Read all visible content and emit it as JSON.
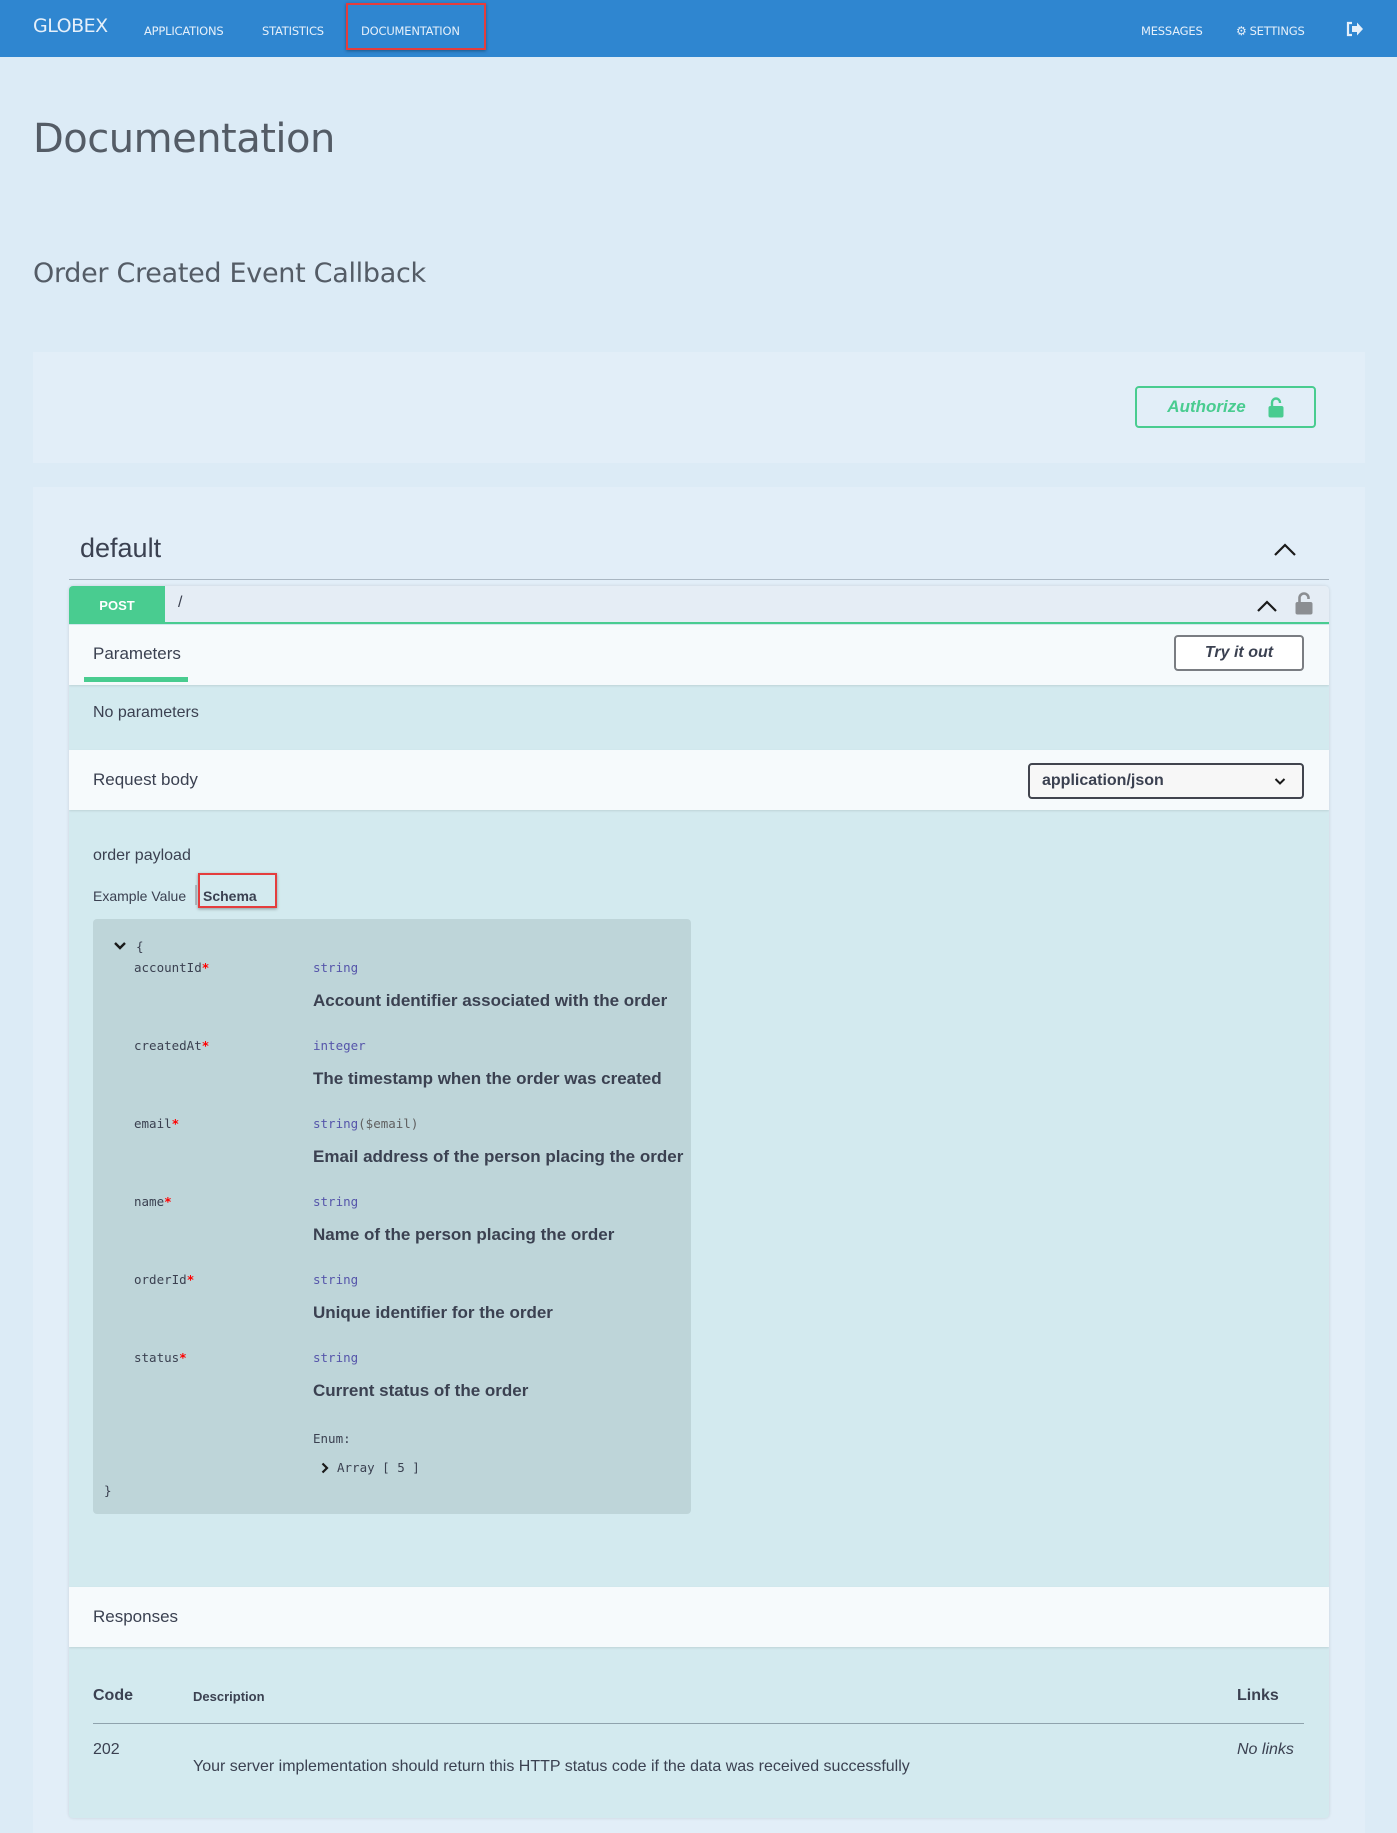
{
  "nav": {
    "brand": "GLOBEX",
    "items": [
      {
        "label": "APPLICATIONS"
      },
      {
        "label": "STATISTICS"
      },
      {
        "label": "DOCUMENTATION",
        "active": true
      }
    ],
    "right_items": [
      {
        "label": "MESSAGES"
      },
      {
        "label": "SETTINGS",
        "icon": "gears-icon"
      },
      {
        "label": "",
        "icon": "logout-icon"
      }
    ]
  },
  "page": {
    "title": "Documentation",
    "api_title": "Order Created Event Callback"
  },
  "auth": {
    "button_label": "Authorize",
    "icon": "unlocked-padlock-icon"
  },
  "tag": {
    "name": "default",
    "expanded": true
  },
  "operation": {
    "method": "POST",
    "path": "/",
    "expanded": true,
    "locked": false,
    "parameters_tab": "Parameters",
    "try_it_out_label": "Try it out",
    "no_parameters_text": "No parameters",
    "request_body_label": "Request body",
    "content_type": "application/json",
    "body_description": "order payload",
    "example_tab_label": "Example Value",
    "schema_tab_label": "Schema",
    "active_tab": "Schema"
  },
  "schema": {
    "open_brace": "{",
    "close_brace": "}",
    "properties": [
      {
        "name": "accountId",
        "required": "*",
        "type": "string",
        "format": "",
        "description": "Account identifier associated with the order"
      },
      {
        "name": "createdAt",
        "required": "*",
        "type": "integer",
        "format": "",
        "description": "The timestamp when the order was created"
      },
      {
        "name": "email",
        "required": "*",
        "type": "string",
        "format": "($email)",
        "description": "Email address of the person placing the order"
      },
      {
        "name": "name",
        "required": "*",
        "type": "string",
        "format": "",
        "description": "Name of the person placing the order"
      },
      {
        "name": "orderId",
        "required": "*",
        "type": "string",
        "format": "",
        "description": "Unique identifier for the order"
      },
      {
        "name": "status",
        "required": "*",
        "type": "string",
        "format": "",
        "description": "Current status of the order"
      }
    ],
    "enum_label": "Enum:",
    "enum_array": "Array [ 5 ]"
  },
  "responses": {
    "title": "Responses",
    "headers": {
      "code": "Code",
      "description": "Description",
      "links": "Links"
    },
    "rows": [
      {
        "code": "202",
        "description": "Your server implementation should return this HTTP status code if the data was received successfully",
        "links": "No links"
      }
    ]
  },
  "colors": {
    "nav_bg": "#2f86d0",
    "post_green": "#49cc90",
    "highlight_red": "#e43d3d",
    "page_bg": "#dcebf6"
  }
}
